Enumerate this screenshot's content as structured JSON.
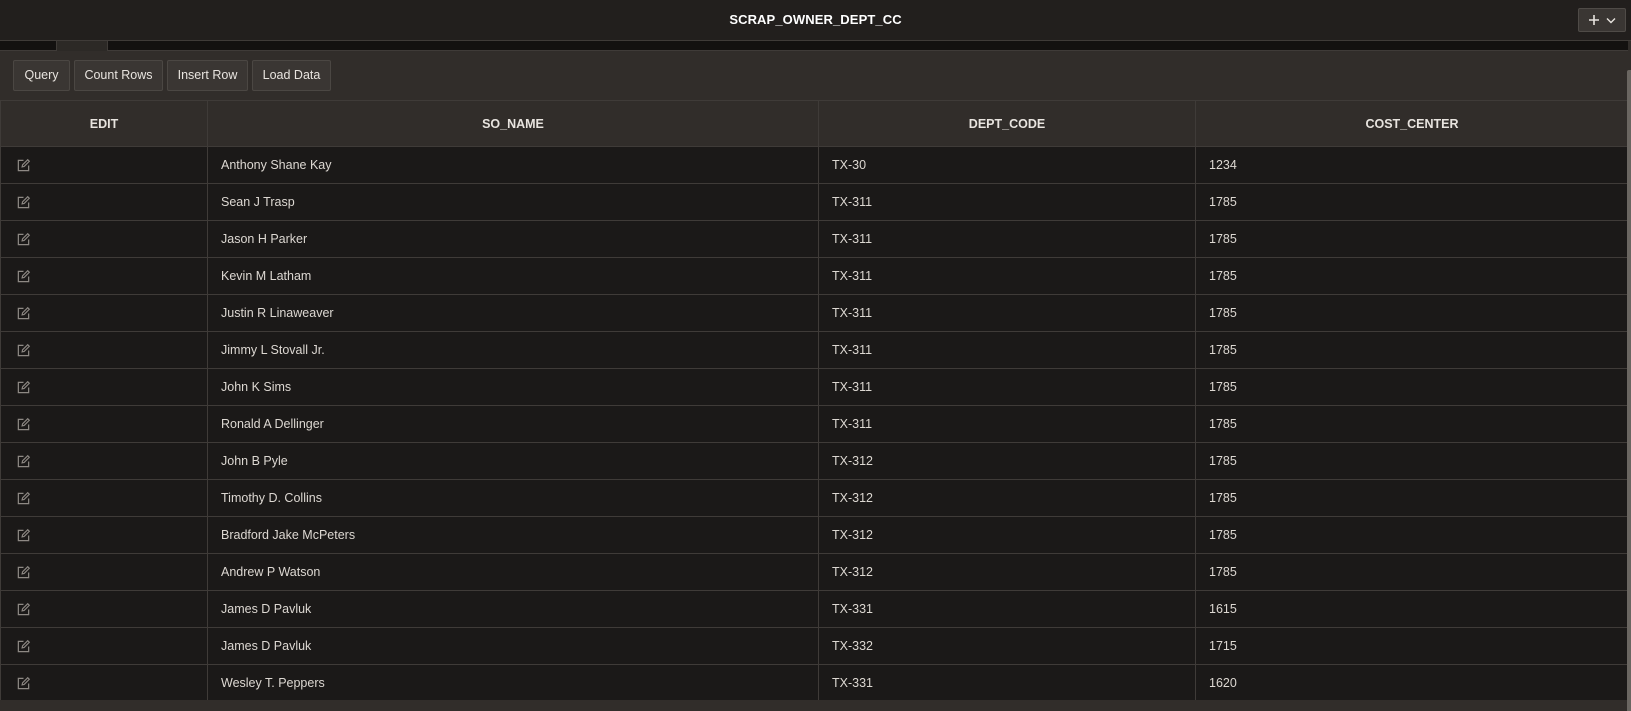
{
  "window": {
    "title": "SCRAP_OWNER_DEPT_CC",
    "add_menu_icon": "plus-icon",
    "add_menu_chevron": "chevron-down-icon"
  },
  "toolbar": {
    "query_label": "Query",
    "count_rows_label": "Count Rows",
    "insert_row_label": "Insert Row",
    "load_data_label": "Load Data"
  },
  "table": {
    "columns": [
      "EDIT",
      "SO_NAME",
      "DEPT_CODE",
      "COST_CENTER"
    ],
    "edit_icon": "edit-icon",
    "rows": [
      {
        "so_name": "Anthony Shane Kay",
        "dept_code": "TX-30",
        "cost_center": "1234"
      },
      {
        "so_name": "Sean J Trasp",
        "dept_code": "TX-311",
        "cost_center": "1785"
      },
      {
        "so_name": "Jason H Parker",
        "dept_code": "TX-311",
        "cost_center": "1785"
      },
      {
        "so_name": "Kevin M Latham",
        "dept_code": "TX-311",
        "cost_center": "1785"
      },
      {
        "so_name": "Justin R Linaweaver",
        "dept_code": "TX-311",
        "cost_center": "1785"
      },
      {
        "so_name": "Jimmy L Stovall Jr.",
        "dept_code": "TX-311",
        "cost_center": "1785"
      },
      {
        "so_name": "John K Sims",
        "dept_code": "TX-311",
        "cost_center": "1785"
      },
      {
        "so_name": "Ronald A Dellinger",
        "dept_code": "TX-311",
        "cost_center": "1785"
      },
      {
        "so_name": "John B Pyle",
        "dept_code": "TX-312",
        "cost_center": "1785"
      },
      {
        "so_name": "Timothy D. Collins",
        "dept_code": "TX-312",
        "cost_center": "1785"
      },
      {
        "so_name": "Bradford Jake McPeters",
        "dept_code": "TX-312",
        "cost_center": "1785"
      },
      {
        "so_name": "Andrew P Watson",
        "dept_code": "TX-312",
        "cost_center": "1785"
      },
      {
        "so_name": "James D Pavluk",
        "dept_code": "TX-331",
        "cost_center": "1615"
      },
      {
        "so_name": "James D Pavluk",
        "dept_code": "TX-332",
        "cost_center": "1715"
      },
      {
        "so_name": "Wesley T. Peppers",
        "dept_code": "TX-331",
        "cost_center": "1620"
      }
    ]
  },
  "colors": {
    "titlebar_bg": "#221f1d",
    "panel_bg": "#312d2a",
    "row_bg": "#1b1918",
    "border": "#3f3b38",
    "text": "#e8e4df"
  }
}
